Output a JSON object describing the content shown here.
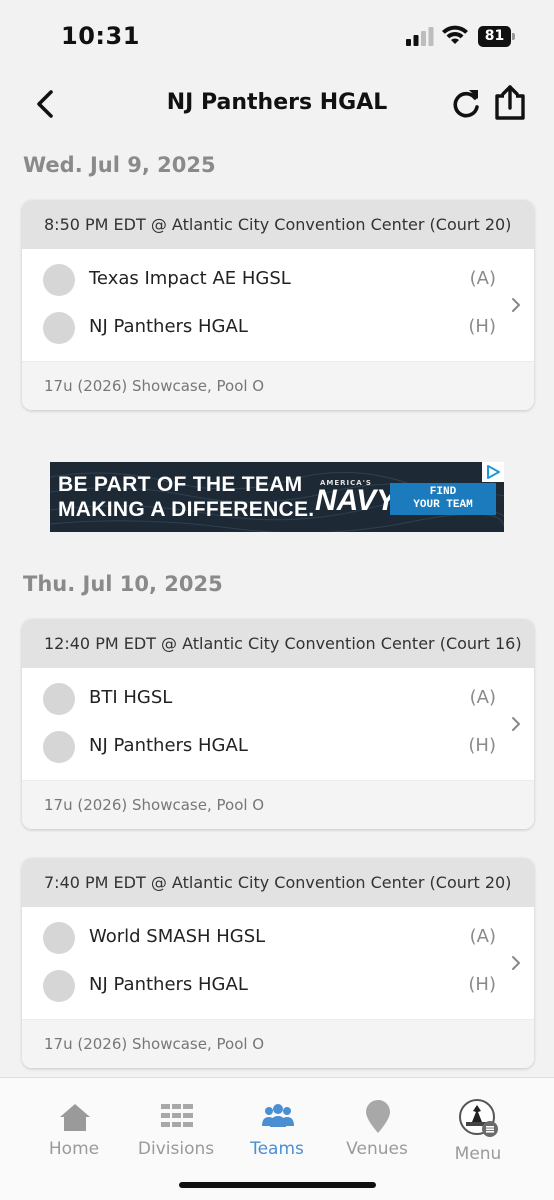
{
  "status": {
    "time": "10:31",
    "battery": "81"
  },
  "nav": {
    "title": "NJ Panthers HGAL"
  },
  "days": [
    {
      "date": "Wed. Jul 9, 2025",
      "games": [
        {
          "time_venue": "8:50 PM EDT @ Atlantic City Convention Center (Court 20)",
          "teams": [
            {
              "name": "Texas Impact AE HGSL",
              "side": "(A)"
            },
            {
              "name": "NJ Panthers HGAL",
              "side": "(H)"
            }
          ],
          "division": "17u (2026) Showcase, Pool O"
        }
      ]
    },
    {
      "date": "Thu. Jul 10, 2025",
      "games": [
        {
          "time_venue": "12:40 PM EDT @ Atlantic City Convention Center (Court 16)",
          "teams": [
            {
              "name": "BTI HGSL",
              "side": "(A)"
            },
            {
              "name": "NJ Panthers HGAL",
              "side": "(H)"
            }
          ],
          "division": "17u (2026) Showcase, Pool O"
        },
        {
          "time_venue": "7:40 PM EDT @ Atlantic City Convention Center (Court 20)",
          "teams": [
            {
              "name": "World SMASH HGSL",
              "side": "(A)"
            },
            {
              "name": "NJ Panthers HGAL",
              "side": "(H)"
            }
          ],
          "division": "17u (2026) Showcase, Pool O"
        }
      ]
    }
  ],
  "ad": {
    "headline_line1": "BE PART OF THE TEAM",
    "headline_line2": "MAKING A DIFFERENCE.",
    "brand_small": "AMERICA'S",
    "brand": "NAVY",
    "cta_line1": "FIND",
    "cta_line2": "YOUR TEAM"
  },
  "tabs": [
    {
      "label": "Home",
      "icon": "home-icon"
    },
    {
      "label": "Divisions",
      "icon": "divisions-icon"
    },
    {
      "label": "Teams",
      "icon": "teams-icon",
      "active": true
    },
    {
      "label": "Venues",
      "icon": "venue-pin-icon"
    },
    {
      "label": "Menu",
      "icon": "menu-avatar-icon"
    }
  ],
  "colors": {
    "accent": "#4a8fd4",
    "inactive": "#9a9a9a",
    "card_header": "#e2e2e2",
    "ad_cta": "#1c7bbd"
  }
}
